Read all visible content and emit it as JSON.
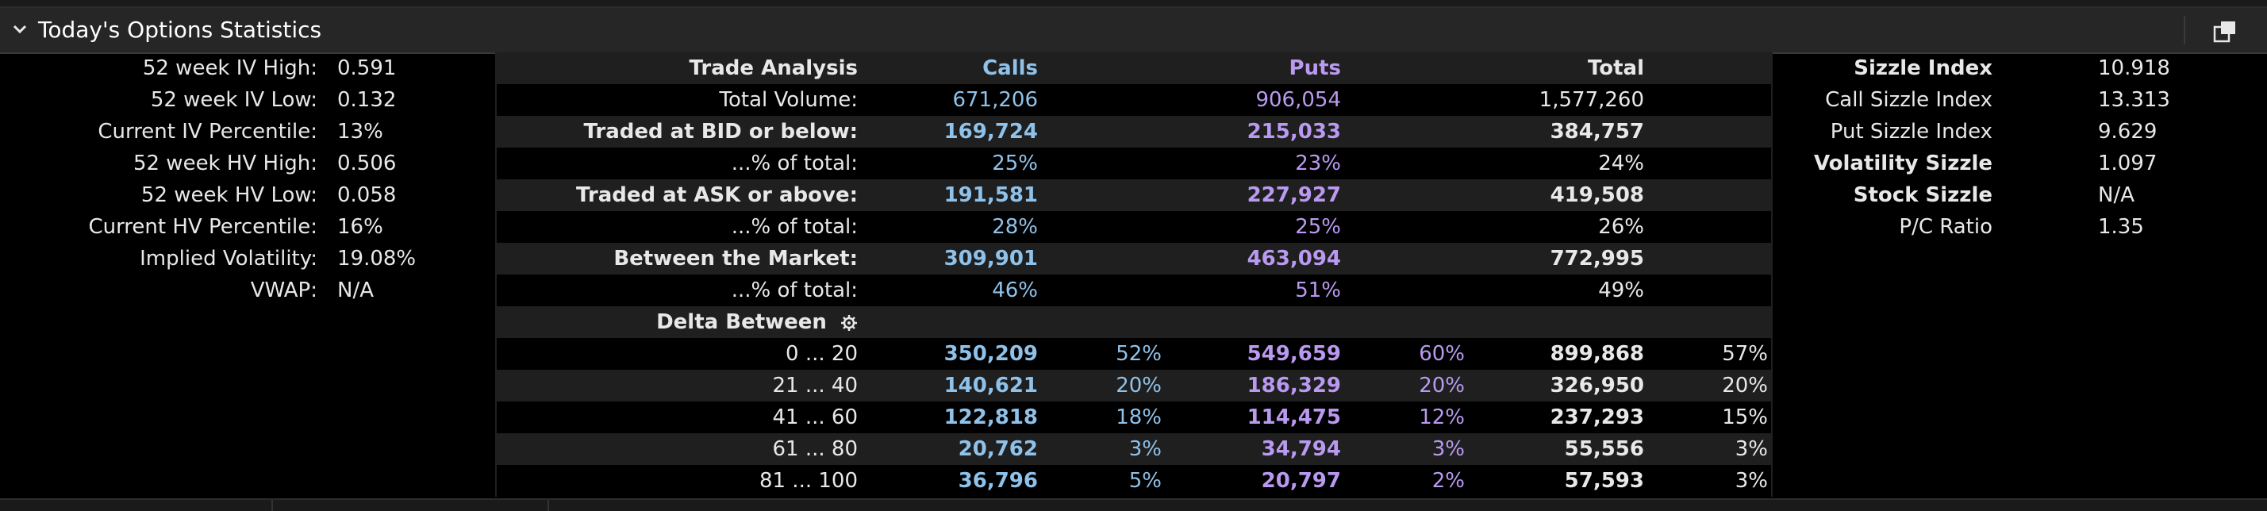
{
  "header": {
    "title": "Today's Options Statistics"
  },
  "left_stats": [
    {
      "label": "52 week IV High:",
      "value": "0.591"
    },
    {
      "label": "52 week IV Low:",
      "value": "0.132"
    },
    {
      "label": "Current IV Percentile:",
      "value": "13%"
    },
    {
      "label": "52 week HV High:",
      "value": "0.506"
    },
    {
      "label": "52 week HV Low:",
      "value": "0.058"
    },
    {
      "label": "Current HV Percentile:",
      "value": "16%"
    },
    {
      "label": "Implied Volatility:",
      "value": "19.08%"
    },
    {
      "label": "VWAP:",
      "value": "N/A"
    }
  ],
  "trade_analysis": {
    "header": {
      "label": "Trade Analysis",
      "calls": "Calls",
      "puts": "Puts",
      "total": "Total"
    },
    "rows": [
      {
        "label": "Total Volume:",
        "calls": "671,206",
        "puts": "906,054",
        "total": "1,577,260",
        "bold": false
      },
      {
        "label": "Traded at BID or below:",
        "calls": "169,724",
        "puts": "215,033",
        "total": "384,757",
        "bold": true
      },
      {
        "label": "...% of total:",
        "calls": "25%",
        "puts": "23%",
        "total": "24%",
        "bold": false
      },
      {
        "label": "Traded at ASK or above:",
        "calls": "191,581",
        "puts": "227,927",
        "total": "419,508",
        "bold": true
      },
      {
        "label": "...% of total:",
        "calls": "28%",
        "puts": "25%",
        "total": "26%",
        "bold": false
      },
      {
        "label": "Between the Market:",
        "calls": "309,901",
        "puts": "463,094",
        "total": "772,995",
        "bold": true
      },
      {
        "label": "...% of total:",
        "calls": "46%",
        "puts": "51%",
        "total": "49%",
        "bold": false
      }
    ],
    "delta_header": "Delta Between",
    "delta_rows": [
      {
        "range": "0 ... 20",
        "calls": "350,209",
        "calls_pct": "52%",
        "puts": "549,659",
        "puts_pct": "60%",
        "total": "899,868",
        "total_pct": "57%"
      },
      {
        "range": "21 ... 40",
        "calls": "140,621",
        "calls_pct": "20%",
        "puts": "186,329",
        "puts_pct": "20%",
        "total": "326,950",
        "total_pct": "20%"
      },
      {
        "range": "41 ... 60",
        "calls": "122,818",
        "calls_pct": "18%",
        "puts": "114,475",
        "puts_pct": "12%",
        "total": "237,293",
        "total_pct": "15%"
      },
      {
        "range": "61 ... 80",
        "calls": "20,762",
        "calls_pct": "3%",
        "puts": "34,794",
        "puts_pct": "3%",
        "total": "55,556",
        "total_pct": "3%"
      },
      {
        "range": "81 ... 100",
        "calls": "36,796",
        "calls_pct": "5%",
        "puts": "20,797",
        "puts_pct": "2%",
        "total": "57,593",
        "total_pct": "3%"
      }
    ]
  },
  "right_stats": [
    {
      "label": "Sizzle Index",
      "value": "10.918",
      "bold": true
    },
    {
      "label": "Call Sizzle Index",
      "value": "13.313",
      "bold": false
    },
    {
      "label": "Put Sizzle Index",
      "value": "9.629",
      "bold": false
    },
    {
      "label": "Volatility Sizzle",
      "value": "1.097",
      "bold": true
    },
    {
      "label": "Stock Sizzle",
      "value": "N/A",
      "bold": true
    },
    {
      "label": "P/C Ratio",
      "value": "1.35",
      "bold": false
    }
  ],
  "colors": {
    "calls": "#8fc2ea",
    "puts": "#b99af0",
    "background": "#000000",
    "header": "#262626"
  },
  "icons": {
    "collapse": "chevron-down-icon",
    "popout": "popout-window-icon",
    "settings": "gear-icon"
  }
}
